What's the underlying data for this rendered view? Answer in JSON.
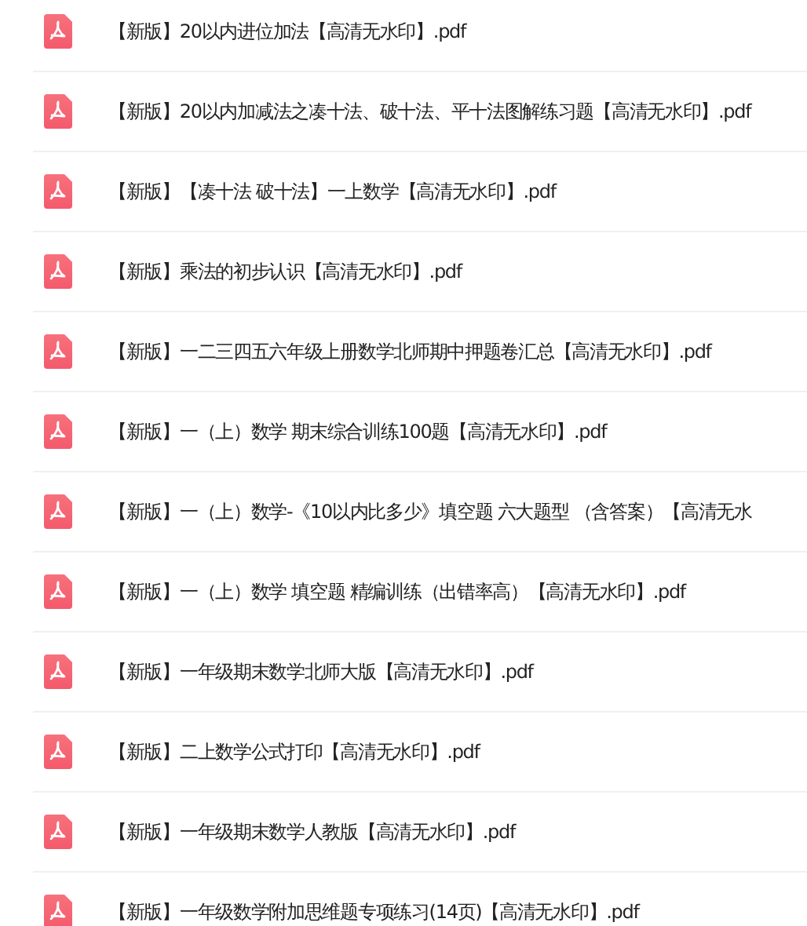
{
  "files": [
    {
      "name": "【新版】20以内进位加法【高清无水印】.pdf"
    },
    {
      "name": "【新版】20以内加减法之凑十法、破十法、平十法图解练习题【高清无水印】.pdf"
    },
    {
      "name": "【新版】【凑十法 破十法】一上数学【高清无水印】.pdf"
    },
    {
      "name": "【新版】乘法的初步认识【高清无水印】.pdf"
    },
    {
      "name": "【新版】一二三四五六年级上册数学北师期中押题卷汇总【高清无水印】.pdf"
    },
    {
      "name": "【新版】一（上）数学 期末综合训练100题【高清无水印】.pdf"
    },
    {
      "name": "【新版】一（上）数学-《10以内比多少》填空题  六大题型 （含答案）【高清无水"
    },
    {
      "name": "【新版】一（上）数学 填空题 精编训练（出错率高）【高清无水印】.pdf"
    },
    {
      "name": "【新版】一年级期末数学北师大版【高清无水印】.pdf"
    },
    {
      "name": "【新版】二上数学公式打印【高清无水印】.pdf"
    },
    {
      "name": "【新版】一年级期末数学人教版【高清无水印】.pdf"
    },
    {
      "name": "【新版】一年级数学附加思维题专项练习(14页)【高清无水印】.pdf"
    }
  ]
}
